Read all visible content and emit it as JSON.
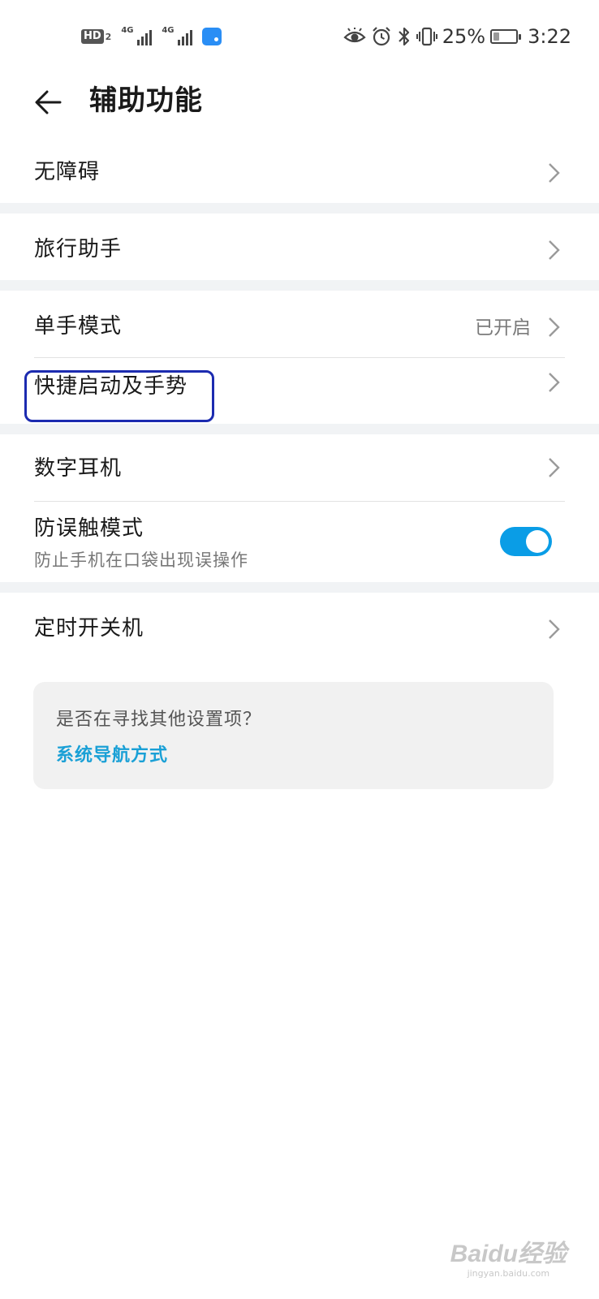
{
  "status_bar": {
    "hd_label": "HD",
    "hd_sub": "2",
    "sim1_gen": "4G",
    "sim2_gen": "4G",
    "battery_percent": "25%",
    "battery_level": 0.25,
    "time": "3:22",
    "icons": [
      "hd-voice-icon",
      "signal-icon",
      "signal-icon",
      "message-notification-icon",
      "eye-comfort-icon",
      "alarm-icon",
      "bluetooth-icon",
      "vibrate-icon",
      "battery-icon"
    ]
  },
  "header": {
    "title": "辅助功能",
    "back_icon": "arrow-left-icon"
  },
  "groups": {
    "g1": {
      "item": "无障碍"
    },
    "g2": {
      "item": "旅行助手"
    },
    "g3": {
      "one_hand": {
        "label": "单手模式",
        "value": "已开启"
      },
      "gestures": {
        "label": "快捷启动及手势"
      }
    },
    "g4": {
      "earphone": {
        "label": "数字耳机"
      },
      "mistouch": {
        "label": "防误触模式",
        "sub": "防止手机在口袋出现误操作",
        "enabled": true
      }
    },
    "g5": {
      "item": "定时开关机"
    }
  },
  "suggestion": {
    "question": "是否在寻找其他设置项？",
    "link": "系统导航方式"
  },
  "watermark": {
    "main": "Baidu经验",
    "sub": "jingyan.baidu.com"
  },
  "colors": {
    "accent": "#1aa0d6",
    "toggle_on": "#0a9de6",
    "highlight_box": "#1c2bb0",
    "separator": "#f1f3f5"
  }
}
